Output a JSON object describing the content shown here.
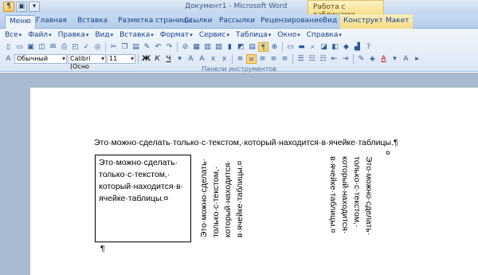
{
  "titlebar": {
    "title": "Документ1 - Microsoft Word",
    "context_group": "Работа с таблицами",
    "qat_icons": [
      "paragraph-icon",
      "save-icon",
      "dropdown-icon"
    ]
  },
  "tabs": [
    "Меню",
    "Главная",
    "Вставка",
    "Разметка страницы",
    "Ссылки",
    "Рассылки",
    "Рецензирование",
    "Вид",
    "Конструктор",
    "Макет"
  ],
  "menubar": [
    "Все",
    "Файл",
    "Правка",
    "Вид",
    "Вставка",
    "Формат",
    "Сервис",
    "Таблица",
    "Окно",
    "Справка"
  ],
  "font_style": "Обычный",
  "font_name": "Calibri (Осно",
  "font_size": "11",
  "format_buttons": {
    "bold": "Ж",
    "italic": "К",
    "underline": "Ч"
  },
  "ribbon_group_label": "Панели инструментов",
  "document": {
    "paragraph": "Это·можно·сделать·только·с·текстом,·который·находится·в·ячейке·таблицы.¶",
    "cell_lines": [
      "Это·можно·сделать·",
      "только·с·текстом,·",
      "который·находится·в·",
      "ячейке·таблицы.¤"
    ],
    "vertical_up_lines": [
      "Это·можно·сделать·",
      "только·с·текстом,·",
      "который·находится·",
      "в·ячейке·таблицы.¤"
    ],
    "vertical_down_lines": [
      "Это·можно·сделать·",
      "только·с·текстом,·",
      "который·находится·",
      "в·ячейке·таблицы.¤"
    ],
    "cell_end_mark": "¤",
    "after_table_mark": "¶"
  }
}
